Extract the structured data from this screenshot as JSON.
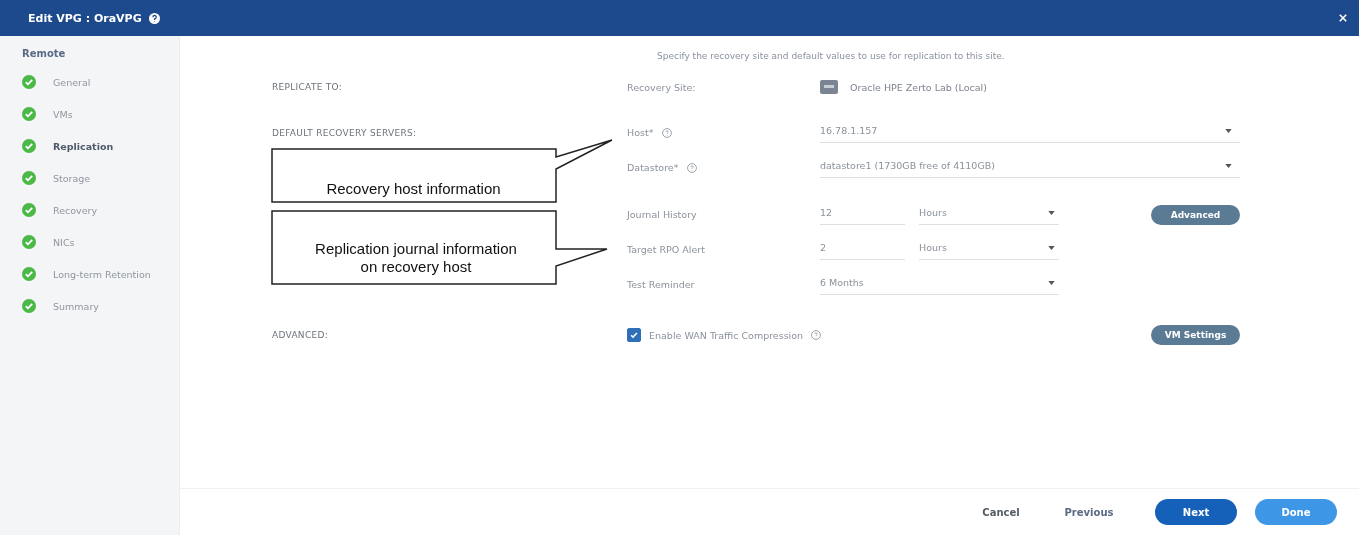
{
  "window": {
    "title": "Edit VPG : OraVPG"
  },
  "sidebar": {
    "heading": "Remote",
    "steps": [
      {
        "label": "General",
        "completed": true,
        "selected": false
      },
      {
        "label": "VMs",
        "completed": true,
        "selected": false
      },
      {
        "label": "Replication",
        "completed": true,
        "selected": true
      },
      {
        "label": "Storage",
        "completed": true,
        "selected": false
      },
      {
        "label": "Recovery",
        "completed": true,
        "selected": false
      },
      {
        "label": "NICs",
        "completed": true,
        "selected": false
      },
      {
        "label": "Long-term Retention",
        "completed": true,
        "selected": false
      },
      {
        "label": "Summary",
        "completed": true,
        "selected": false
      }
    ]
  },
  "description": "Specify the recovery site and default values to use for replication to this site.",
  "replicate_to": {
    "heading": "REPLICATE TO:",
    "label": "Recovery Site:",
    "value": "Oracle HPE Zerto Lab (Local)"
  },
  "default_recovery_servers": {
    "heading": "DEFAULT RECOVERY SERVERS:",
    "fields": [
      {
        "label": "Host*",
        "value": "16.78.1.157"
      },
      {
        "label": "Datastore*",
        "value": "datastore1 (1730GB free of 4110GB)"
      }
    ]
  },
  "journal": {
    "fields": [
      {
        "label": "Journal History",
        "value": "12",
        "unit": "Hours"
      },
      {
        "label": "Target RPO Alert",
        "value": "2",
        "unit": "Hours"
      },
      {
        "label": "Test Reminder",
        "value": "6 Months"
      }
    ],
    "button": "Advanced"
  },
  "advanced": {
    "heading": "ADVANCED:",
    "checkbox": {
      "label": "Enable WAN Traffic Compression",
      "checked": true
    },
    "button": "VM Settings"
  },
  "callouts": [
    {
      "text": "Recovery host information"
    },
    {
      "text": "Replication journal information on recovery host"
    }
  ],
  "footer": {
    "buttons": [
      {
        "label": "Cancel",
        "kind": "plain"
      },
      {
        "label": "Previous",
        "kind": "link"
      },
      {
        "label": "Next",
        "kind": "primary"
      },
      {
        "label": "Done",
        "kind": "secondary"
      }
    ]
  }
}
